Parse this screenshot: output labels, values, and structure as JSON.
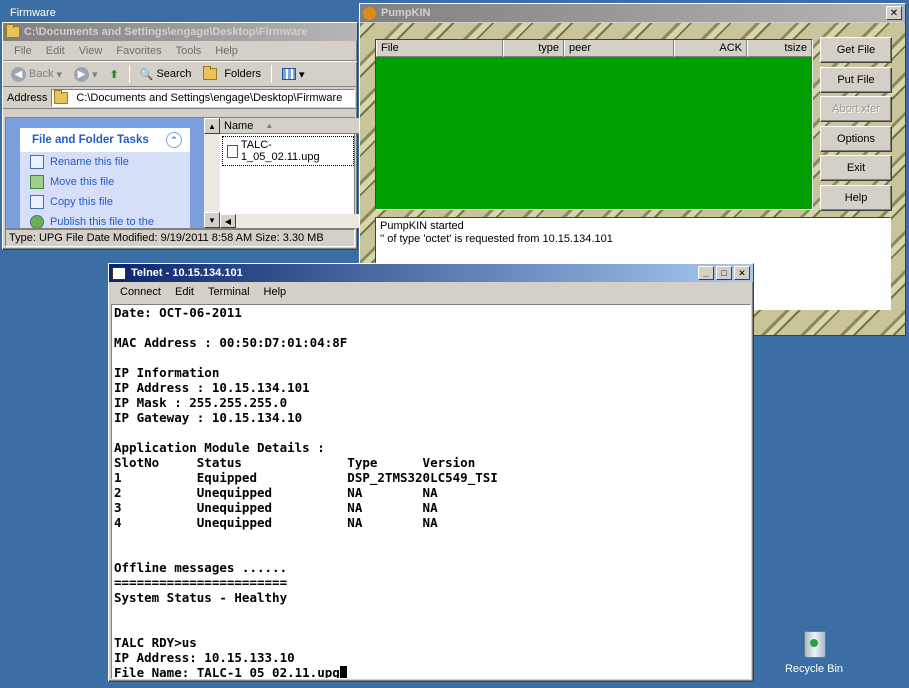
{
  "desktop": {
    "title": "Firmware",
    "recycle_bin_label": "Recycle Bin"
  },
  "explorer": {
    "title": "C:\\Documents and Settings\\engage\\Desktop\\Firmware",
    "menu": [
      "File",
      "Edit",
      "View",
      "Favorites",
      "Tools",
      "Help"
    ],
    "toolbar": {
      "back_label": "Back",
      "search_label": "Search",
      "folders_label": "Folders"
    },
    "address_label": "Address",
    "address_value": "C:\\Documents and Settings\\engage\\Desktop\\Firmware",
    "tasks_heading": "File and Folder Tasks",
    "tasks": [
      "Rename this file",
      "Move this file",
      "Copy this file",
      "Publish this file to the"
    ],
    "column_name": "Name",
    "file_name": "TALC-1_05_02.11.upg",
    "status": "Type: UPG File Date Modified: 9/19/2011 8:58 AM Size: 3.30 MB"
  },
  "pumpkin": {
    "title": "PumpKIN",
    "columns": [
      "File",
      "type",
      "peer",
      "ACK",
      "tsize"
    ],
    "buttons": [
      "Get File",
      "Put File",
      "Abort xfer",
      "Options",
      "Exit",
      "Help"
    ],
    "log": [
      "PumpKIN started",
      "'' of type 'octet' is requested from 10.15.134.101"
    ]
  },
  "telnet": {
    "title": "Telnet - 10.15.134.101",
    "menu": [
      "Connect",
      "Edit",
      "Terminal",
      "Help"
    ],
    "lines": [
      "Date: OCT-06-2011",
      "",
      "MAC Address : 00:50:D7:01:04:8F",
      "",
      "IP Information",
      "IP Address : 10.15.134.101",
      "IP Mask : 255.255.255.0",
      "IP Gateway : 10.15.134.10",
      "",
      "Application Module Details :",
      "SlotNo     Status              Type      Version",
      "1          Equipped            DSP_2TMS320LC549_TSI",
      "2          Unequipped          NA        NA",
      "3          Unequipped          NA        NA",
      "4          Unequipped          NA        NA",
      "",
      "",
      "Offline messages ......",
      "=======================",
      "System Status - Healthy",
      "",
      "",
      "TALC RDY>us",
      "IP Address: 10.15.133.10",
      "File Name: TALC-1_05_02.11.upg"
    ]
  }
}
